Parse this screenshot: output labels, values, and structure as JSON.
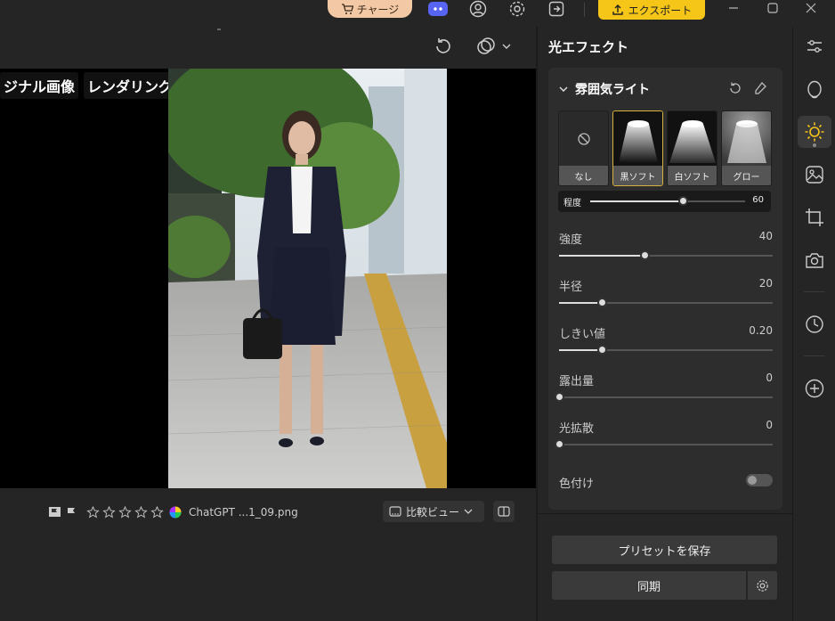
{
  "titlebar": {
    "charge_label": "チャージ",
    "export_label": "エクスポート",
    "accent_color": "#f5c518",
    "icons": [
      "cart-icon",
      "discord-icon",
      "account-icon",
      "settings-icon",
      "share-icon",
      "minimize-icon",
      "maximize-icon",
      "close-icon"
    ]
  },
  "canvas": {
    "left_label": "ジナル画像",
    "right_label": "レンダリング",
    "filename": "ChatGPT ...1_09.png",
    "compare_label": "比較ビュー",
    "star_rating": 0,
    "star_count": 5
  },
  "panel": {
    "title": "光エフェクト",
    "section_title": "雰囲気ライト",
    "presets": [
      {
        "label": "なし"
      },
      {
        "label": "黒ソフト"
      },
      {
        "label": "白ソフト"
      },
      {
        "label": "グロー"
      }
    ],
    "selected_preset": "黒ソフト",
    "degree": {
      "label": "程度",
      "value": "60",
      "fraction": 0.6
    },
    "sliders": [
      {
        "label": "強度",
        "value": "40",
        "fraction": 0.4
      },
      {
        "label": "半径",
        "value": "20",
        "fraction": 0.2
      },
      {
        "label": "しきい値",
        "value": "0.20",
        "fraction": 0.2
      },
      {
        "label": "露出量",
        "value": "0",
        "fraction": 0.0
      },
      {
        "label": "光拡散",
        "value": "0",
        "fraction": 0.0
      }
    ],
    "colorize_label": "色付け",
    "colorize_on": false,
    "save_preset_label": "プリセットを保存",
    "sync_label": "同期"
  },
  "toolbar_right": {
    "tools": [
      "adjust-icon",
      "face-icon",
      "light-effect-icon",
      "sticker-icon",
      "crop-icon",
      "camera-icon",
      "history-icon",
      "add-icon"
    ],
    "active_tool": "light-effect-icon"
  }
}
